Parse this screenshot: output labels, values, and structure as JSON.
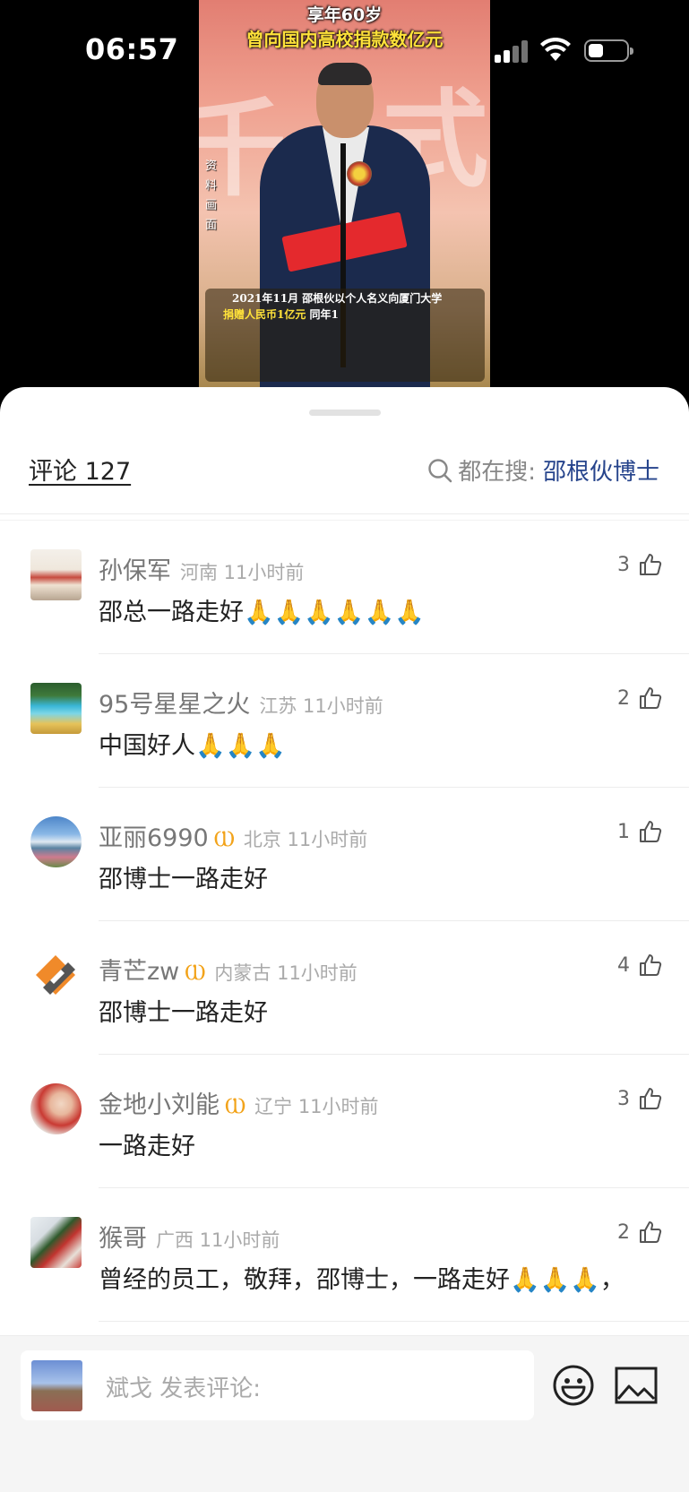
{
  "status_bar": {
    "time": "06:57"
  },
  "video": {
    "title_line1": "享年60岁",
    "title_line2": "曾向国内高校捐款数亿元",
    "side_label": "资料画面",
    "caption_line1": "2021年11月 邵根伙以个人名义向厦门大学",
    "caption_line2_highlight": "捐赠人民币1亿元",
    "caption_line2_rest": " 同年1",
    "bg_chars": [
      "千",
      "式"
    ]
  },
  "comments_header": {
    "title": "评论 127",
    "search_label": "都在搜:",
    "search_term": "邵根伙博士"
  },
  "comments": [
    {
      "user": "孙保军",
      "badge": "",
      "meta": "河南 11小时前",
      "likes": "3",
      "text": "邵总一路走好🙏🙏🙏🙏🙏🙏",
      "avatar": "avatar-building",
      "round": false
    },
    {
      "user": "95号星星之火",
      "badge": "",
      "meta": "江苏 11小时前",
      "likes": "2",
      "text": "中国好人🙏🙏🙏",
      "avatar": "avatar-lake",
      "round": false
    },
    {
      "user": "亚丽6990",
      "badge": "Ⲱ",
      "meta": "北京 11小时前",
      "likes": "1",
      "text": "邵博士一路走好",
      "avatar": "avatar-sea",
      "round": true
    },
    {
      "user": "青芒zw",
      "badge": "Ⲱ",
      "meta": "内蒙古 11小时前",
      "likes": "4",
      "text": "邵博士一路走好",
      "avatar": "avatar-logo",
      "round": false
    },
    {
      "user": "金地小刘能",
      "badge": "Ⲱ",
      "meta": "辽宁 11小时前",
      "likes": "3",
      "text": "一路走好",
      "avatar": "avatar-person",
      "round": true
    },
    {
      "user": "猴哥",
      "badge": "",
      "meta": "广西 11小时前",
      "likes": "2",
      "text": "曾经的员工，敬拜，邵博士，一路走好🙏🙏🙏，",
      "avatar": "avatar-lanterns",
      "round": false
    }
  ],
  "composer": {
    "placeholder": "斌戈 发表评论:",
    "emoji_icon": "emoji-icon",
    "image_icon": "image-icon"
  },
  "colors": {
    "accent_link": "#26448c",
    "badge": "#f2a31a",
    "text_primary": "#222222",
    "text_meta": "#aaaaaa"
  }
}
